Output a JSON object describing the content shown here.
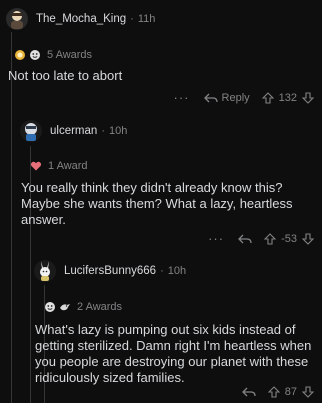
{
  "comments": [
    {
      "username": "The_Mocha_King",
      "time": "11h",
      "awards_label": "5 Awards",
      "body": "Not too late to abort",
      "reply_label": "Reply",
      "score": "132"
    },
    {
      "username": "ulcerman",
      "time": "10h",
      "awards_label": "1 Award",
      "body": "You really think they didn't already know this? Maybe she wants them? What a lazy, heartless answer.",
      "score": "-53"
    },
    {
      "username": "LucifersBunny666",
      "time": "10h",
      "awards_label": "2 Awards",
      "body": "What's lazy is pumping out six kids instead of getting sterilized. Damn right I'm heartless when you people are destroying our planet with these ridiculously sized families.",
      "score": "87"
    }
  ],
  "separator": "·",
  "more_glyph": "···",
  "colors": {
    "background": "#0e0e0e",
    "text": "#d7dadc",
    "meta": "#818384",
    "thread_line": "#343536"
  }
}
